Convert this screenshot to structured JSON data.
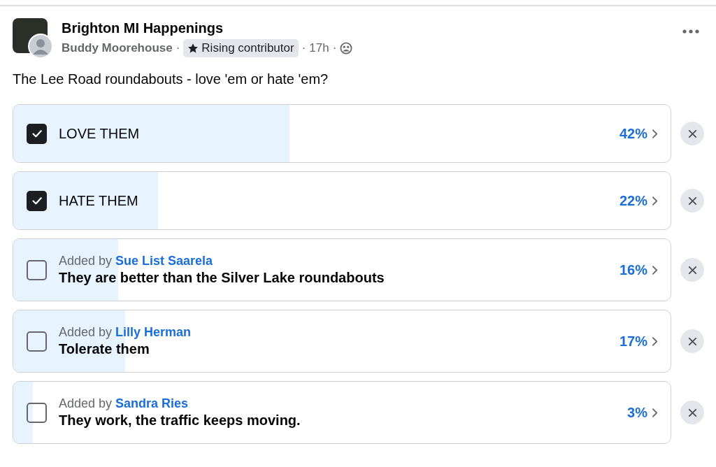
{
  "post": {
    "group_name": "Brighton MI Happenings",
    "author": "Buddy Moorehouse",
    "separator_1": "·",
    "badge": "Rising contributor",
    "separator_2": "·",
    "time": "17h",
    "separator_3": "·",
    "text": "The Lee Road roundabouts - love 'em or hate 'em?"
  },
  "options": [
    {
      "kind": "plain",
      "label": "LOVE THEM",
      "checked": true,
      "level": 0.42,
      "percent": "42%"
    },
    {
      "kind": "plain",
      "label": "HATE THEM",
      "checked": true,
      "level": 0.22,
      "percent": "22%"
    },
    {
      "kind": "added",
      "added_by_label": "Added by",
      "added_by": "Sue List Saarela",
      "label": "They are better than the Silver Lake roundabouts",
      "checked": false,
      "level": 0.16,
      "percent": "16%"
    },
    {
      "kind": "added",
      "added_by_label": "Added by",
      "added_by": "Lilly Herman",
      "label": "Tolerate them",
      "checked": false,
      "level": 0.17,
      "percent": "17%"
    },
    {
      "kind": "added",
      "added_by_label": "Added by",
      "added_by": "Sandra Ries",
      "label": "They work, the traffic keeps moving.",
      "checked": false,
      "level": 0.03,
      "percent": "3%"
    }
  ]
}
